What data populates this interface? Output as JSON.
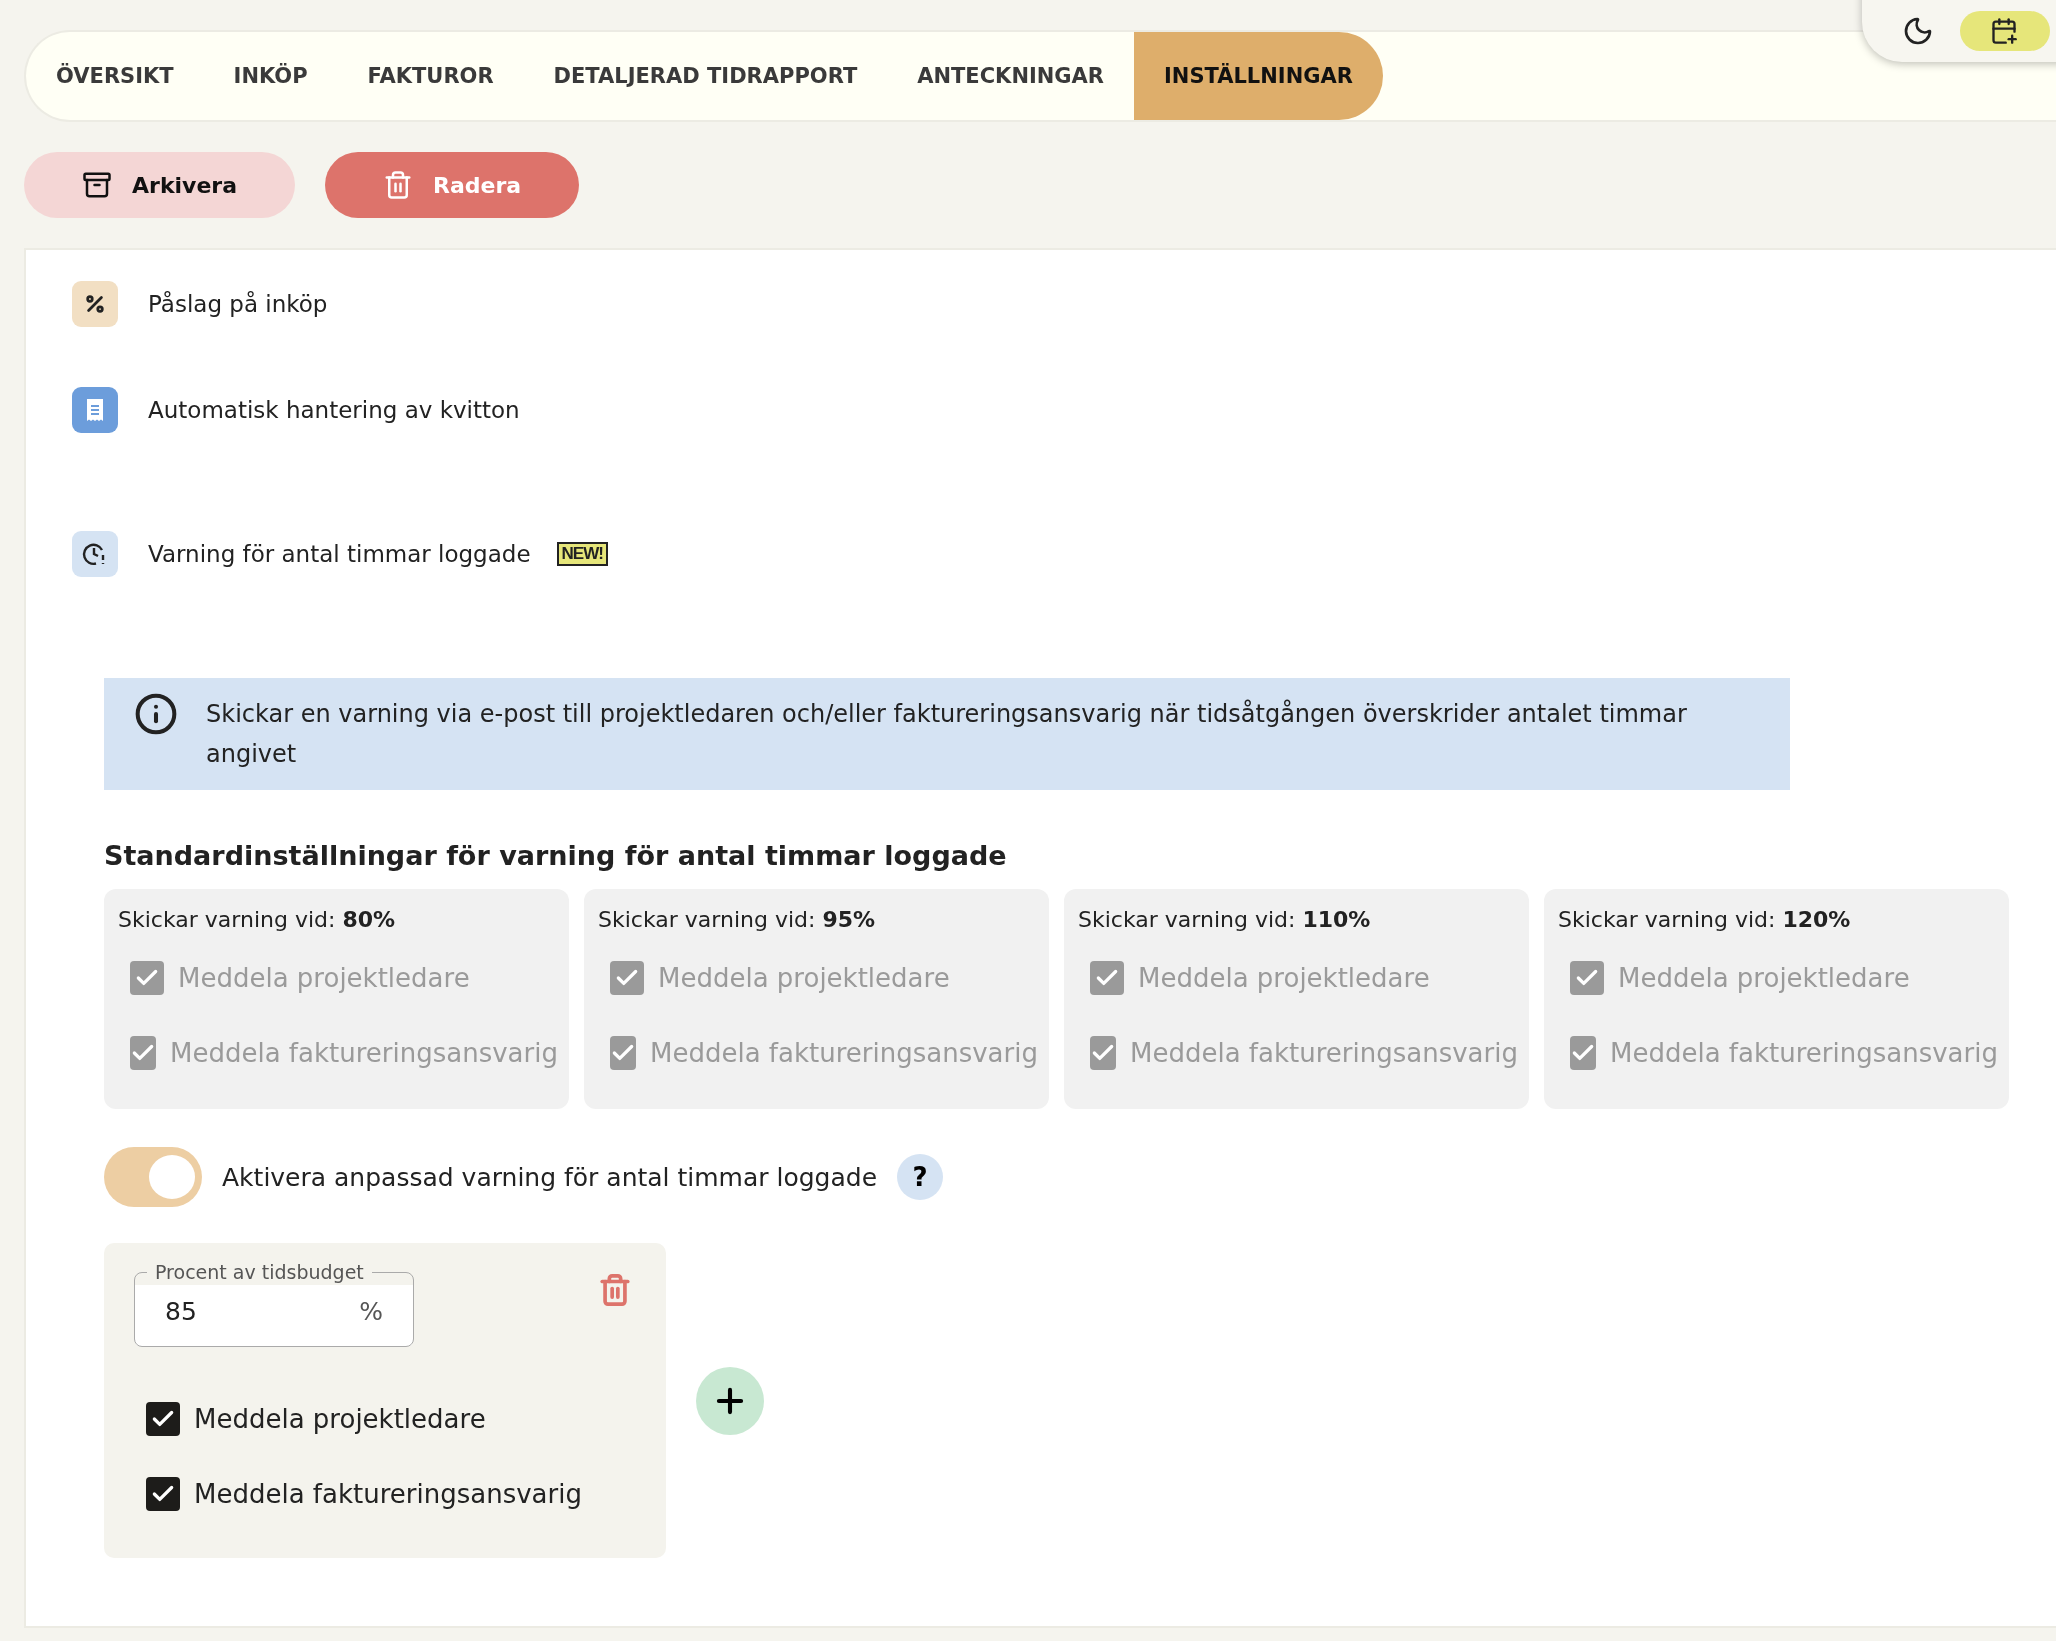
{
  "tabs": [
    {
      "label": "ÖVERSIKT",
      "selected": false
    },
    {
      "label": "INKÖP",
      "selected": false
    },
    {
      "label": "FAKTUROR",
      "selected": false
    },
    {
      "label": "DETALJERAD TIDRAPPORT",
      "selected": false
    },
    {
      "label": "ANTECKNINGAR",
      "selected": false
    },
    {
      "label": "INSTÄLLNINGAR",
      "selected": true
    }
  ],
  "actions": [
    {
      "label": "Arkivera",
      "kind": "archive"
    },
    {
      "label": "Radera",
      "kind": "delete"
    }
  ],
  "settings": [
    {
      "label": "Påslag på inköp",
      "kind": "percent"
    },
    {
      "label": "Automatisk hantering av kvitton",
      "kind": "receipt"
    },
    {
      "label": "Varning för antal timmar loggade",
      "kind": "clock",
      "badge": "NEW!"
    }
  ],
  "info": "Skickar en varning via e-post till projektledaren och/eller faktureringsansvarig när tidsåtgången överskrider antalet timmar angivet",
  "defaults_heading": "Standardinställningar för varning för antal timmar loggade",
  "default_cards": [
    {
      "label": "Skickar varning vid:",
      "value": "80%",
      "options": [
        {
          "label": "Meddela projektledare",
          "checked": true,
          "disabled": true
        },
        {
          "label": "Meddela faktureringsansvarig",
          "checked": true,
          "disabled": true
        }
      ]
    },
    {
      "label": "Skickar varning vid:",
      "value": "95%",
      "options": [
        {
          "label": "Meddela projektledare",
          "checked": true,
          "disabled": true
        },
        {
          "label": "Meddela faktureringsansvarig",
          "checked": true,
          "disabled": true
        }
      ]
    },
    {
      "label": "Skickar varning vid:",
      "value": "110%",
      "options": [
        {
          "label": "Meddela projektledare",
          "checked": true,
          "disabled": true
        },
        {
          "label": "Meddela faktureringsansvarig",
          "checked": true,
          "disabled": true
        }
      ]
    },
    {
      "label": "Skickar varning vid:",
      "value": "120%",
      "options": [
        {
          "label": "Meddela projektledare",
          "checked": true,
          "disabled": true
        },
        {
          "label": "Meddela faktureringsansvarig",
          "checked": true,
          "disabled": true
        }
      ]
    }
  ],
  "custom_toggle": {
    "label": "Aktivera anpassad varning för antal timmar loggade",
    "on": true,
    "help": "?"
  },
  "custom_rules": [
    {
      "field_label": "Procent av tidsbudget",
      "value": "85",
      "unit": "%",
      "options": [
        {
          "label": "Meddela projektledare",
          "checked": true,
          "disabled": false
        },
        {
          "label": "Meddela faktureringsansvarig",
          "checked": true,
          "disabled": false
        }
      ]
    }
  ]
}
